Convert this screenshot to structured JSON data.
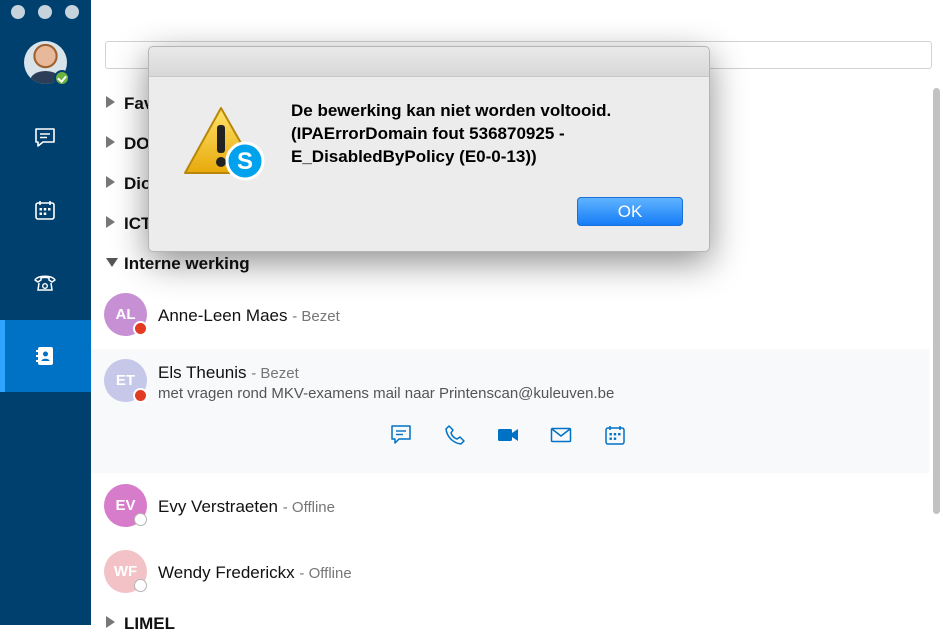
{
  "sidebar": {
    "nav": [
      {
        "name": "chat-icon"
      },
      {
        "name": "calendar-icon"
      },
      {
        "name": "phone-icon"
      },
      {
        "name": "contacts-icon",
        "active": true
      }
    ]
  },
  "groups": {
    "fav": "Fav",
    "do": "DO",
    "dio": "Dio",
    "ict": "ICT",
    "interne": "Interne werking",
    "limel": "LIMEL"
  },
  "contacts": [
    {
      "initials": "AL",
      "name": "Anne-Leen Maes",
      "status": "- Bezet",
      "color": "#c78fd4"
    },
    {
      "initials": "ET",
      "name": "Els Theunis",
      "status": "- Bezet",
      "note": "met vragen rond MKV-examens mail naar Printenscan@kuleuven.be",
      "color": "#c6c8ea"
    },
    {
      "initials": "EV",
      "name": "Evy Verstraeten",
      "status": "- Offline",
      "color": "#d77ccb"
    },
    {
      "initials": "WF",
      "name": "Wendy Frederickx",
      "status": "- Offline",
      "color": "#f3c2c6"
    }
  ],
  "dialog": {
    "line1": "De bewerking kan niet worden voltooid.",
    "line2": "(IPAErrorDomain fout 536870925 -",
    "line3": "E_DisabledByPolicy (E0-0-13))",
    "ok_label": "OK"
  },
  "colors": {
    "sidebar": "#00406f",
    "active": "#0072c6",
    "busy": "#e33a23",
    "icon": "#0072c6"
  }
}
